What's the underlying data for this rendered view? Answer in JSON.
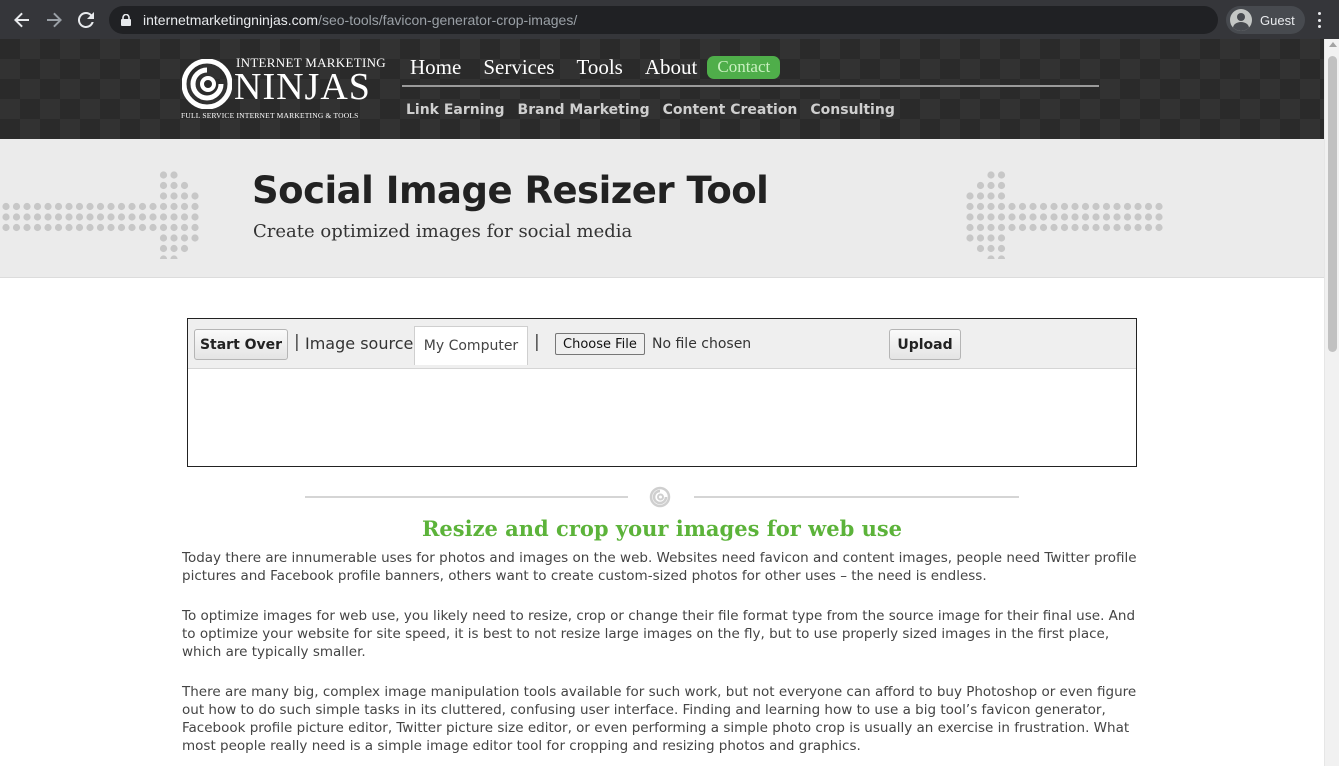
{
  "browser": {
    "url_domain": "internetmarketingninjas.com",
    "url_path": "/seo-tools/favicon-generator-crop-images/",
    "profile_label": "Guest"
  },
  "site": {
    "logo": {
      "top_text": "INTERNET MARKETING",
      "main_text": "NINJAS",
      "tagline": "FULL SERVICE INTERNET MARKETING & TOOLS"
    },
    "main_nav": [
      {
        "label": "Home"
      },
      {
        "label": "Services"
      },
      {
        "label": "Tools"
      },
      {
        "label": "About"
      }
    ],
    "contact_label": "Contact",
    "sub_nav": [
      {
        "label": "Link Earning"
      },
      {
        "label": "Brand Marketing"
      },
      {
        "label": "Content Creation"
      },
      {
        "label": "Consulting"
      }
    ]
  },
  "hero": {
    "title": "Social Image Resizer Tool",
    "subtitle": "Create optimized images for social media"
  },
  "tool": {
    "start_over_label": "Start Over",
    "separator": "|",
    "image_source_label": "Image source:",
    "source_tab_label": "My Computer",
    "choose_file_label": "Choose File",
    "no_file_text": "No file chosen",
    "upload_label": "Upload"
  },
  "content": {
    "heading": "Resize and crop your images for web use",
    "paragraphs": [
      "Today there are innumerable uses for photos and images on the web. Websites need favicon and content images, people need Twitter profile pictures and Facebook profile banners, others want to create custom-sized photos for other uses – the need is endless.",
      "To optimize images for web use, you likely need to resize, crop or change their file format type from the source image for their final use. And to optimize your website for site speed, it is best to not resize large images on the fly, but to use properly sized images in the first place, which are typically smaller.",
      "There are many big, complex image manipulation tools available for such work, but not everyone can afford to buy Photoshop or even figure out how to do such simple tasks in its cluttered, confusing user interface. Finding and learning how to use a big tool’s favicon generator, Facebook profile picture editor, Twitter picture size editor, or even performing a simple photo crop is usually an exercise in frustration. What most people really need is a simple image editor tool for cropping and resizing photos and graphics."
    ]
  },
  "colors": {
    "accent_green": "#5cb33a",
    "contact_bg": "#4fae4a",
    "header_bg": "#2a2a2a",
    "chrome_bg": "#35363a"
  }
}
